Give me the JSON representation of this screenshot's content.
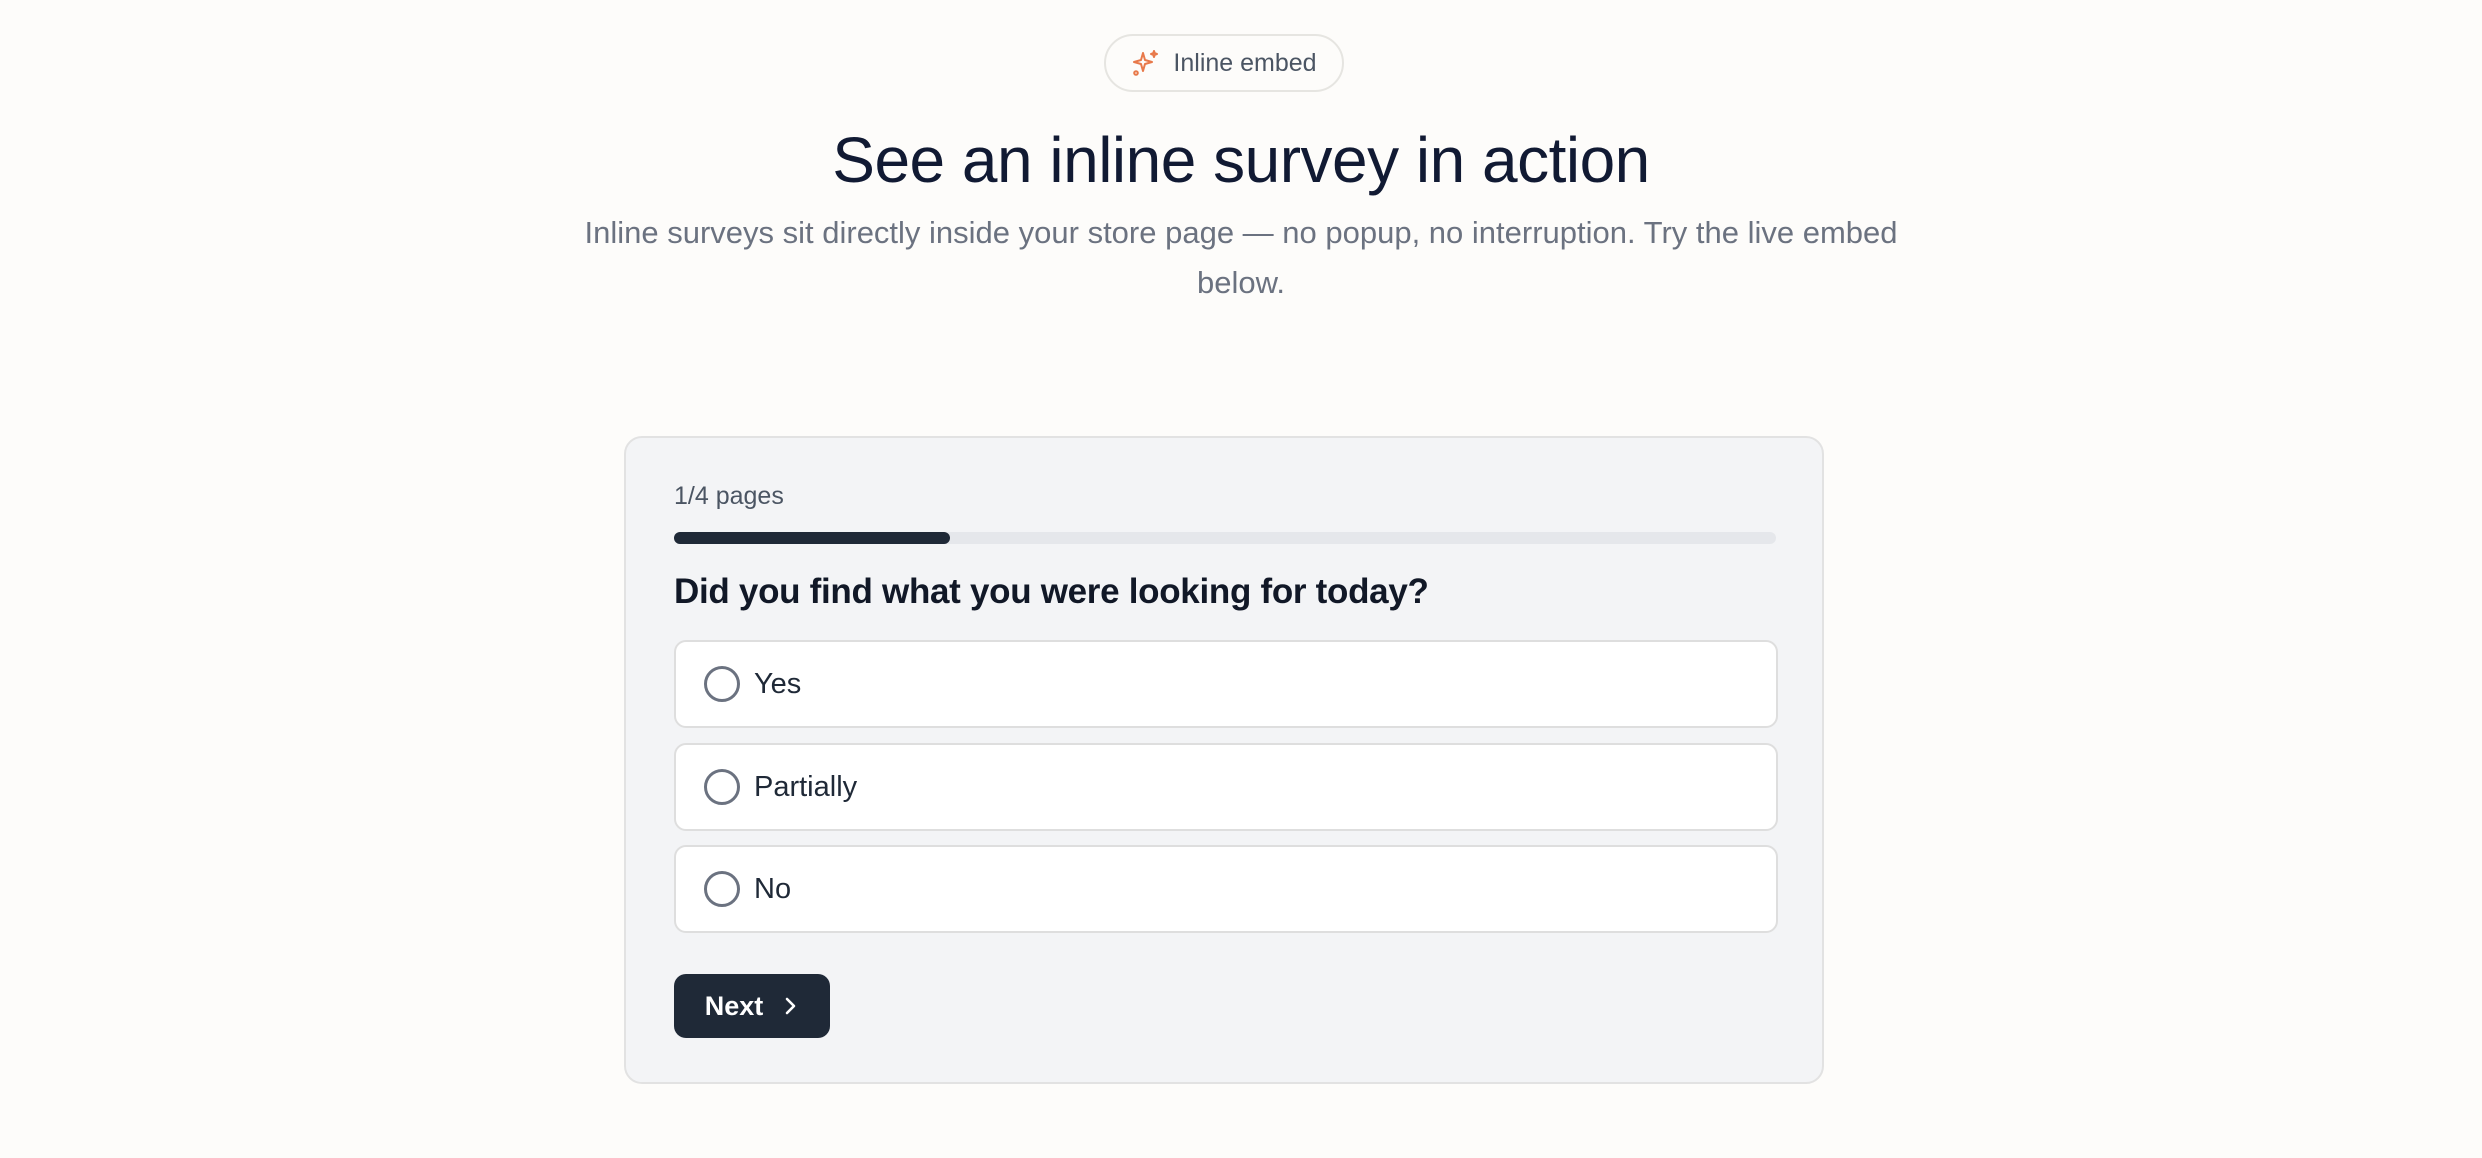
{
  "header": {
    "badge_label": "Inline embed",
    "badge_icon": "sparkle-icon",
    "title": "See an inline survey in action",
    "subtitle": "Inline surveys sit directly inside your store page — no popup, no interruption. Try the live embed below."
  },
  "survey": {
    "page_indicator": "1/4 pages",
    "progress": 0.25,
    "question": "Did you find what you were looking for today?",
    "options": [
      {
        "label": "Yes",
        "selected": false
      },
      {
        "label": "Partially",
        "selected": false
      },
      {
        "label": "No",
        "selected": false
      }
    ],
    "next_label": "Next",
    "next_icon": "chevron-right-icon"
  },
  "colors": {
    "accent": "#e8794a",
    "button_bg": "#1f2937",
    "progress_fill": "#1f2937",
    "progress_track": "#e5e7eb"
  }
}
